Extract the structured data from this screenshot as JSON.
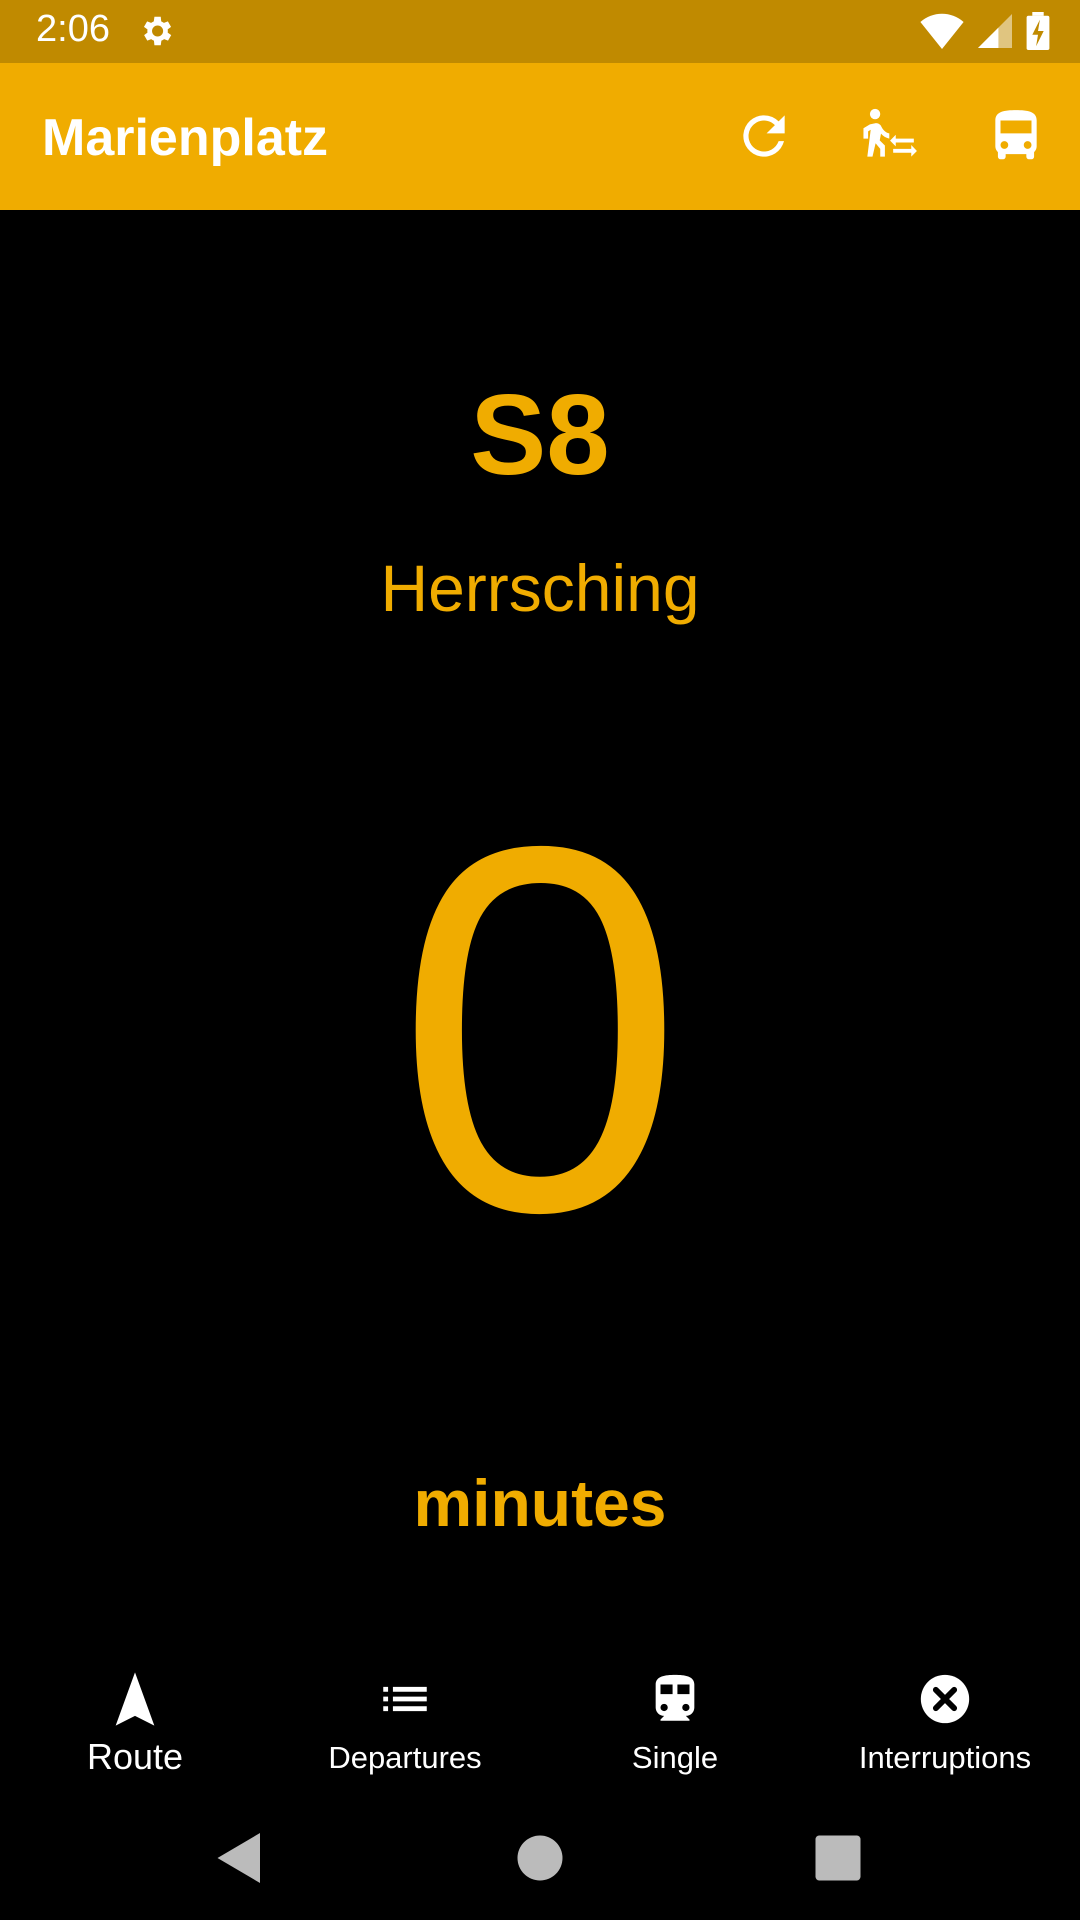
{
  "status_bar": {
    "time": "2:06",
    "icons": [
      "settings-gear-icon",
      "wifi-icon",
      "cell-signal-icon",
      "battery-charging-icon"
    ]
  },
  "app_bar": {
    "title": "Marienplatz",
    "actions": [
      "refresh-icon",
      "walk-transfer-icon",
      "bus-icon"
    ]
  },
  "departure": {
    "line": "S8",
    "destination": "Herrsching",
    "minutes_value": "0",
    "minutes_label": "minutes"
  },
  "bottom_nav": {
    "items": [
      {
        "label": "Route",
        "icon": "navigation-arrow-icon",
        "active": true
      },
      {
        "label": "Departures",
        "icon": "list-icon",
        "active": false
      },
      {
        "label": "Single",
        "icon": "train-icon",
        "active": false
      },
      {
        "label": "Interruptions",
        "icon": "cancel-circle-icon",
        "active": false
      }
    ]
  },
  "system_nav": [
    "back-icon",
    "home-icon",
    "recents-icon"
  ],
  "colors": {
    "accent": "#f0ac00",
    "status_bar": "#c08a00",
    "background": "#000000"
  }
}
